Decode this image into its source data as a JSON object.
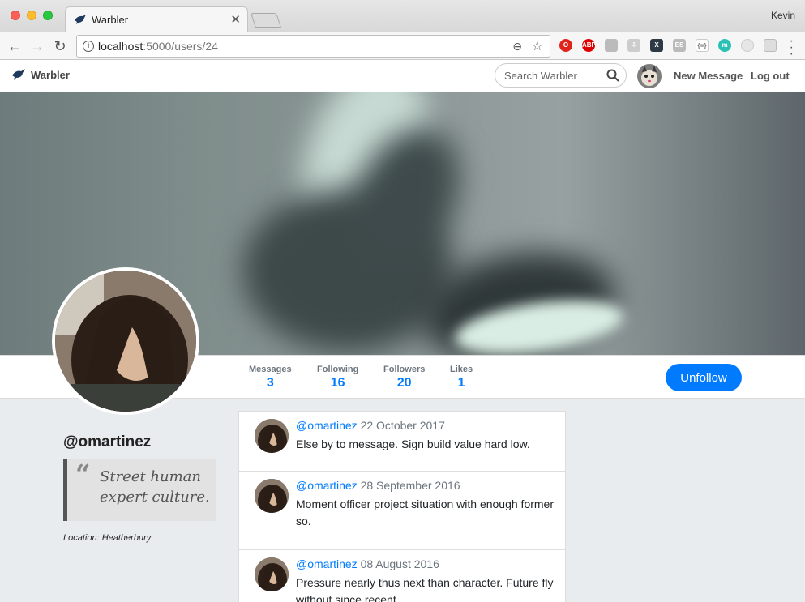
{
  "browser": {
    "tab_title": "Warbler",
    "url_host": "localhost",
    "url_rest": ":5000/users/24",
    "profile_name": "Kevin"
  },
  "nav": {
    "brand": "Warbler",
    "search_placeholder": "Search Warbler",
    "new_message": "New Message",
    "logout": "Log out"
  },
  "stats": [
    {
      "label": "Messages",
      "value": "3"
    },
    {
      "label": "Following",
      "value": "16"
    },
    {
      "label": "Followers",
      "value": "20"
    },
    {
      "label": "Likes",
      "value": "1"
    }
  ],
  "follow_button": "Unfollow",
  "profile": {
    "username": "@omartinez",
    "bio_quote_mark": "“",
    "bio": "Street human expert culture.",
    "location": "Location: Heatherbury"
  },
  "messages": [
    {
      "user": "@omartinez",
      "date": "22 October 2017",
      "text": "Else by to message. Sign build value hard low."
    },
    {
      "user": "@omartinez",
      "date": "28 September 2016",
      "text": "Moment officer project situation with enough former so."
    },
    {
      "user": "@omartinez",
      "date": "08 August 2016",
      "text": "Pressure nearly thus next than character. Future fly without since recent."
    }
  ],
  "colors": {
    "accent": "#007bff",
    "page_bg": "#e9ecef"
  }
}
